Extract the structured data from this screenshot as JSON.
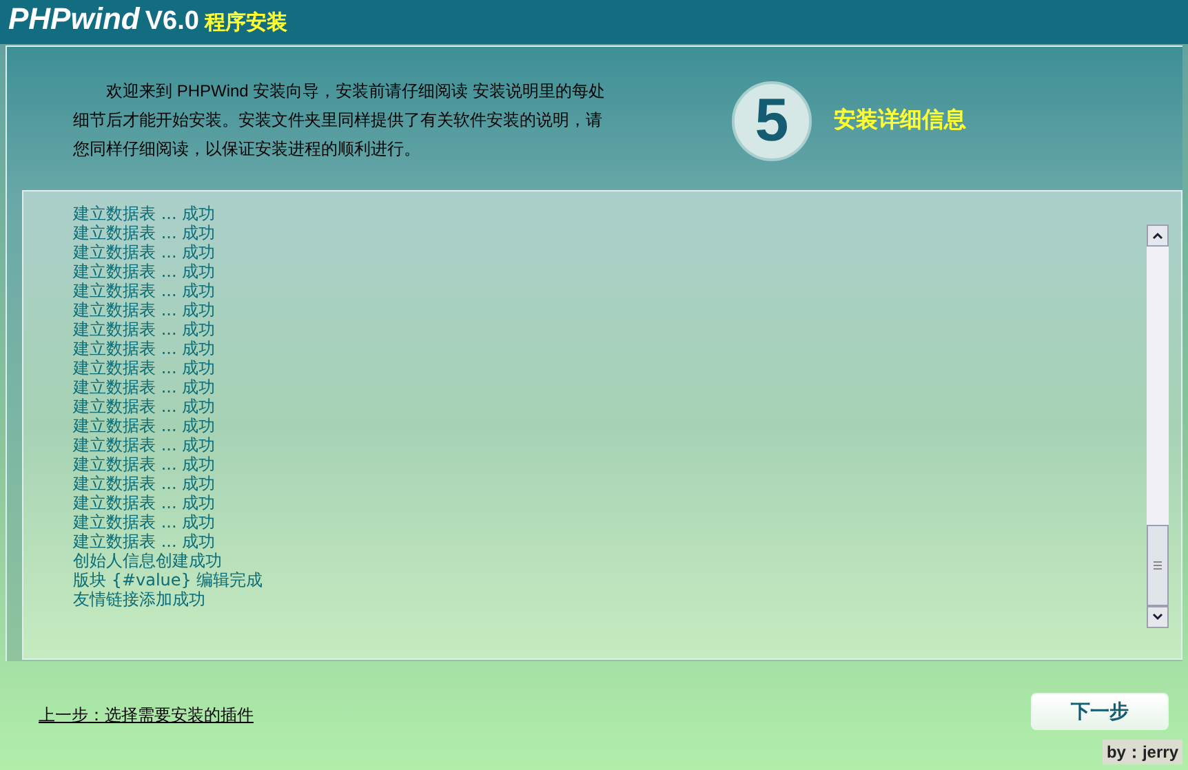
{
  "header": {
    "brand": "PHPwind",
    "version": "V6.0",
    "subtitle": "程序安装"
  },
  "intro": {
    "text": "欢迎来到 PHPWind 安装向导，安装前请仔细阅读 安装说明里的每处细节后才能开始安装。安装文件夹里同样提供了有关软件安装的说明，请您同样仔细阅读，以保证安装进程的顺利进行。"
  },
  "step": {
    "number": "5",
    "title": "安装详细信息"
  },
  "log": {
    "lines": [
      "建立数据表 ... 成功",
      "建立数据表 ... 成功",
      "建立数据表 ... 成功",
      "建立数据表 ... 成功",
      "建立数据表 ... 成功",
      "建立数据表 ... 成功",
      "建立数据表 ... 成功",
      "建立数据表 ... 成功",
      "建立数据表 ... 成功",
      "建立数据表 ... 成功",
      "建立数据表 ... 成功",
      "建立数据表 ... 成功",
      "建立数据表 ... 成功",
      "建立数据表 ... 成功",
      "建立数据表 ... 成功",
      "建立数据表 ... 成功",
      "建立数据表 ... 成功",
      "建立数据表 ... 成功",
      "创始人信息创建成功",
      "版块 {#value} 编辑完成",
      "友情链接添加成功"
    ]
  },
  "footer": {
    "prev_link": "上一步：选择需要安装的插件",
    "next_button": "下一步",
    "credit": "by：jerry"
  }
}
